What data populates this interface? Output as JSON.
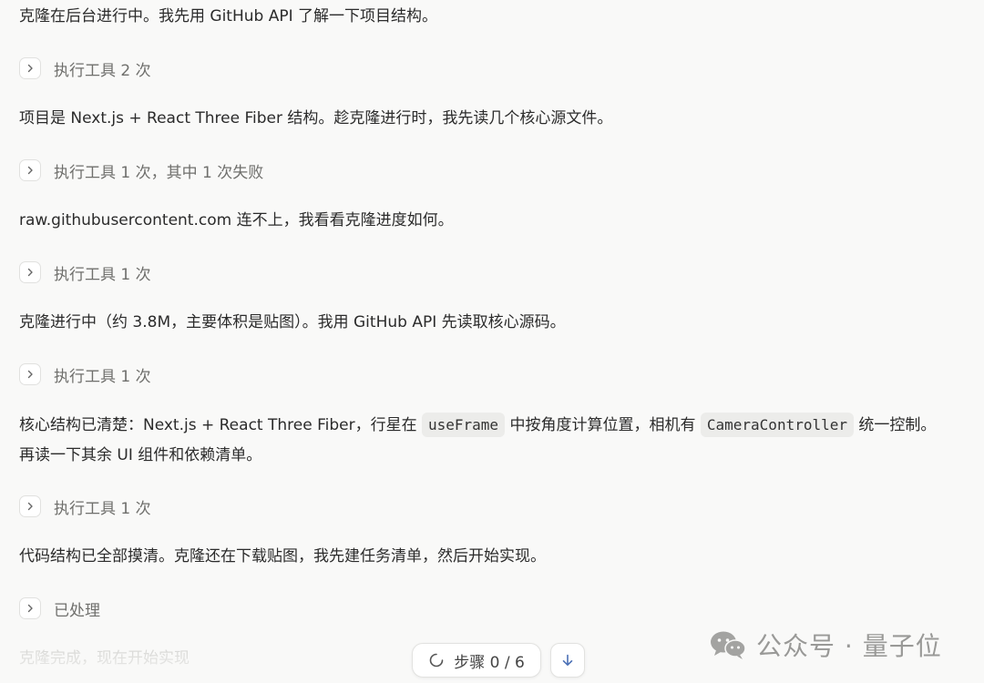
{
  "messages": [
    {
      "text": "克隆在后台进行中。我先用 GitHub API 了解一下项目结构。"
    },
    {
      "text": "项目是 Next.js + React Three Fiber 结构。趁克隆进行时，我先读几个核心源文件。"
    },
    {
      "text": "raw.githubusercontent.com 连不上，我看看克隆进度如何。"
    },
    {
      "text": "克隆进行中（约 3.8M，主要体积是贴图）。我用 GitHub API 先读取核心源码。"
    },
    {
      "part1": "核心结构已清楚：Next.js + React Three Fiber，行星在",
      "code1": "useFrame",
      "part2": "中按角度计算位置，相机有",
      "code2": "CameraController",
      "part3": "统一控制。",
      "line2": "再读一下其余 UI 组件和依赖清单。"
    },
    {
      "text": "代码结构已全部摸清。克隆还在下载贴图，我先建任务清单，然后开始实现。"
    }
  ],
  "tool_calls": [
    {
      "label": "执行工具 2 次"
    },
    {
      "label": "执行工具 1 次，其中 1 次失败"
    },
    {
      "label": "执行工具 1 次"
    },
    {
      "label": "执行工具 1 次"
    },
    {
      "label": "执行工具 1 次"
    },
    {
      "label": "已处理"
    }
  ],
  "faded_text": "克隆完成，现在开始实现",
  "step_indicator": {
    "label": "步骤 0 / 6",
    "icon": "spinner-icon"
  },
  "scroll_button": {
    "icon": "arrow-down-icon"
  },
  "watermark": {
    "text": "公众号 · 量子位",
    "icon": "wechat-logo-icon"
  },
  "colors": {
    "background": "#f9f9f8",
    "text": "#2b2b2b",
    "muted": "#6f6f6c",
    "code_bg": "#ececea",
    "accent": "#4a6fb5"
  }
}
